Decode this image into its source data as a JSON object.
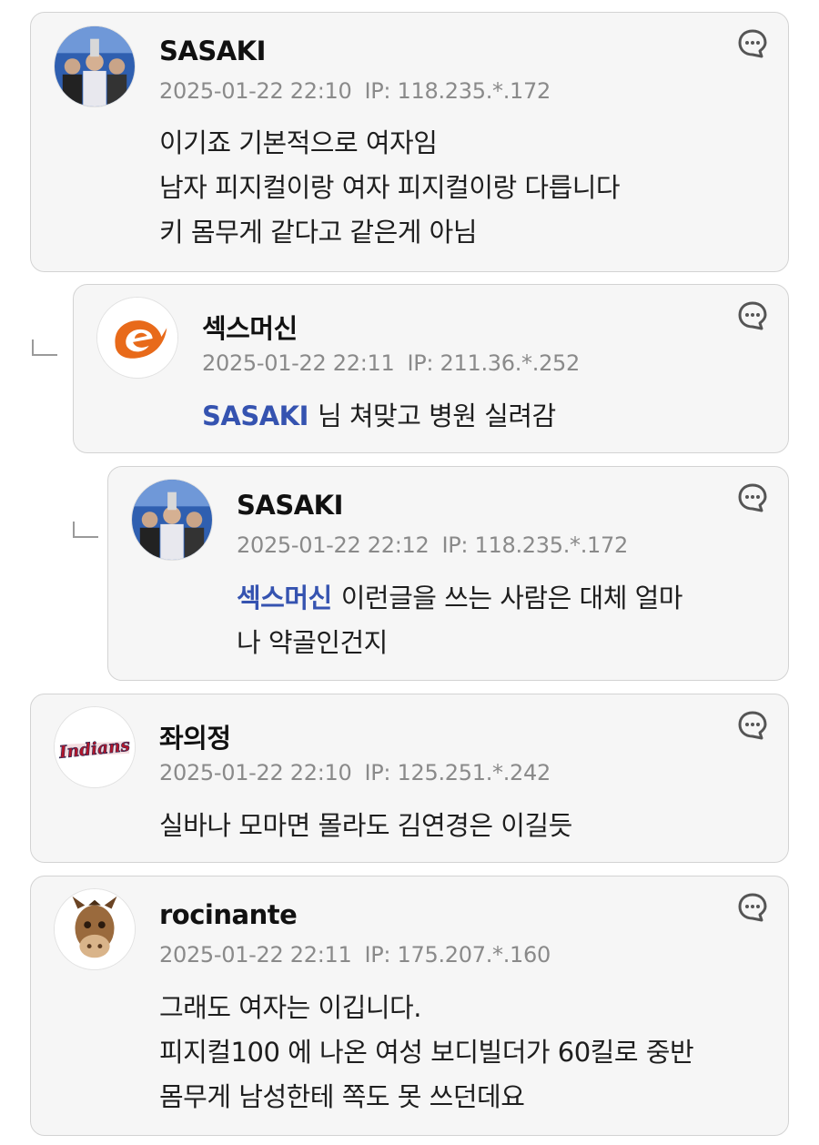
{
  "comments": [
    {
      "author": "SASAKI",
      "datetime": "2025-01-22 22:10",
      "ip": "IP: 118.235.*.172",
      "avatar_icon": "baseball-team-photo-avatar",
      "lines": [
        "이기죠 기본적으로 여자임",
        "남자 피지컬이랑 여자 피지컬이랑 다릅니다",
        "키 몸무게 같다고 같은게 아님"
      ]
    },
    {
      "author": "섹스머신",
      "datetime": "2025-01-22 22:11",
      "ip": "IP: 211.36.*.252",
      "avatar_icon": "orange-swirl-logo-avatar",
      "mention": "SASAKI",
      "lines": [
        "님 쳐맞고 병원 실려감"
      ]
    },
    {
      "author": "SASAKI",
      "datetime": "2025-01-22 22:12",
      "ip": "IP: 118.235.*.172",
      "avatar_icon": "baseball-team-photo-avatar",
      "mention": "섹스머신",
      "lines": [
        "이런글을 쓰는 사람은 대체 얼마",
        "나 약골인건지"
      ]
    },
    {
      "author": "좌의정",
      "datetime": "2025-01-22 22:10",
      "ip": "IP: 125.251.*.242",
      "avatar_icon": "indians-logo-avatar",
      "avatar_text": "Indians",
      "lines": [
        "실바나 모마면 몰라도 김연경은 이길듯"
      ]
    },
    {
      "author": "rocinante",
      "datetime": "2025-01-22 22:11",
      "ip": "IP: 175.207.*.160",
      "avatar_icon": "horse-face-avatar",
      "lines": [
        "그래도 여자는 이깁니다.",
        "피지컬100 에 나온 여성 보디빌더가 60킬로 중반",
        "몸무게 남성한테 쪽도 못 쓰던데요"
      ]
    }
  ],
  "icons": {
    "reply": "speech-bubble-reply-icon",
    "reply_indent": "reply-indent-corner-icon"
  },
  "colors": {
    "mention": "#3553b0",
    "card_bg": "#f6f6f6",
    "card_border": "#d3d3d3",
    "meta_text": "#8a8a8a"
  }
}
